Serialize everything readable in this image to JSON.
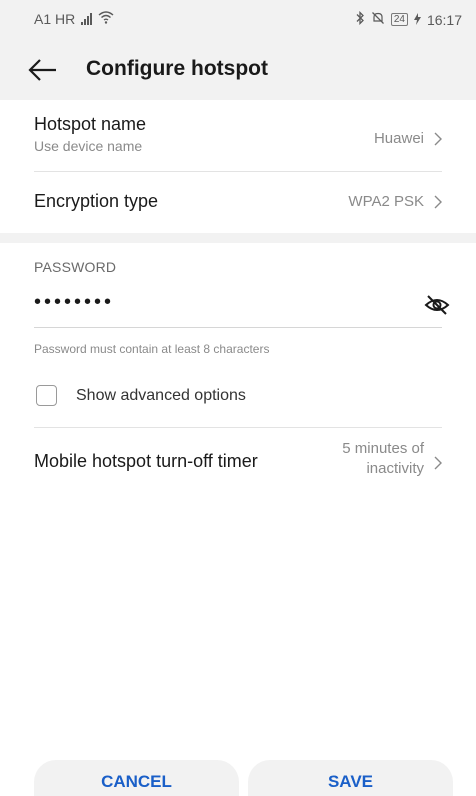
{
  "status_bar": {
    "carrier": "A1 HR",
    "battery": "24",
    "time": "16:17",
    "icons": [
      "signal-icon",
      "wifi-icon",
      "bluetooth-icon",
      "mute-icon",
      "battery-icon",
      "charging-icon"
    ]
  },
  "header": {
    "title": "Configure hotspot",
    "back_icon": "back-arrow-icon"
  },
  "settings": {
    "hotspot_name": {
      "title": "Hotspot name",
      "subtitle": "Use device name",
      "value": "Huawei"
    },
    "encryption": {
      "title": "Encryption type",
      "value": "WPA2 PSK"
    },
    "password": {
      "label": "PASSWORD",
      "value": "••••••••",
      "hint": "Password must contain at least 8 characters",
      "visibility_icon": "eye-off-icon"
    },
    "advanced": {
      "label": "Show advanced options",
      "checked": false
    },
    "timer": {
      "title": "Mobile hotspot turn-off timer",
      "value_line1": "5 minutes of",
      "value_line2": "inactivity"
    }
  },
  "footer": {
    "cancel_label": "CANCEL",
    "save_label": "SAVE"
  },
  "colors": {
    "accent": "#1a5fc8",
    "background": "#ffffff",
    "header_bg": "#f2f2f2",
    "secondary_text": "#8a8a8a"
  }
}
